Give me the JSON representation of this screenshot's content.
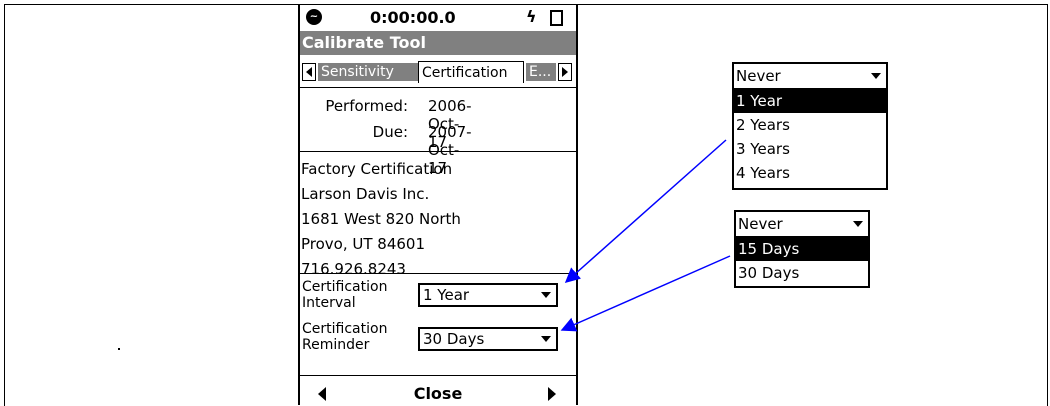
{
  "status": {
    "time": "0:00:00.0",
    "logo_icon": "circle-logo-icon",
    "power_icon": "lightning-icon",
    "battery_icon": "battery-icon"
  },
  "title": "Calibrate Tool",
  "tabs": [
    "Sensitivity",
    "Certification",
    "E..."
  ],
  "active_tab": "Certification",
  "dates": {
    "performed_label": "Performed:",
    "performed_value": "2006-Oct-17",
    "due_label": "Due:",
    "due_value": "2007-Oct-17"
  },
  "address_lines": [
    "Factory Certification",
    "Larson Davis Inc.",
    "1681 West 820 North",
    "Provo, UT 84601",
    "716.926.8243"
  ],
  "interval": {
    "label_line1": "Certification",
    "label_line2": "Interval",
    "value": "1 Year"
  },
  "reminder": {
    "label_line1": "Certification",
    "label_line2": "Reminder",
    "value": "30 Days"
  },
  "bottom": {
    "close_label": "Close"
  },
  "interval_dropdown": {
    "current": "Never",
    "options": [
      "1 Year",
      "2 Years",
      "3 Years",
      "4 Years"
    ],
    "highlighted": "1 Year"
  },
  "reminder_dropdown": {
    "current": "Never",
    "options": [
      "15 Days",
      "30 Days"
    ],
    "highlighted": "15 Days"
  },
  "colors": {
    "titlebar": "#808080",
    "arrow": "#0000ff",
    "highlight": "#000000"
  }
}
